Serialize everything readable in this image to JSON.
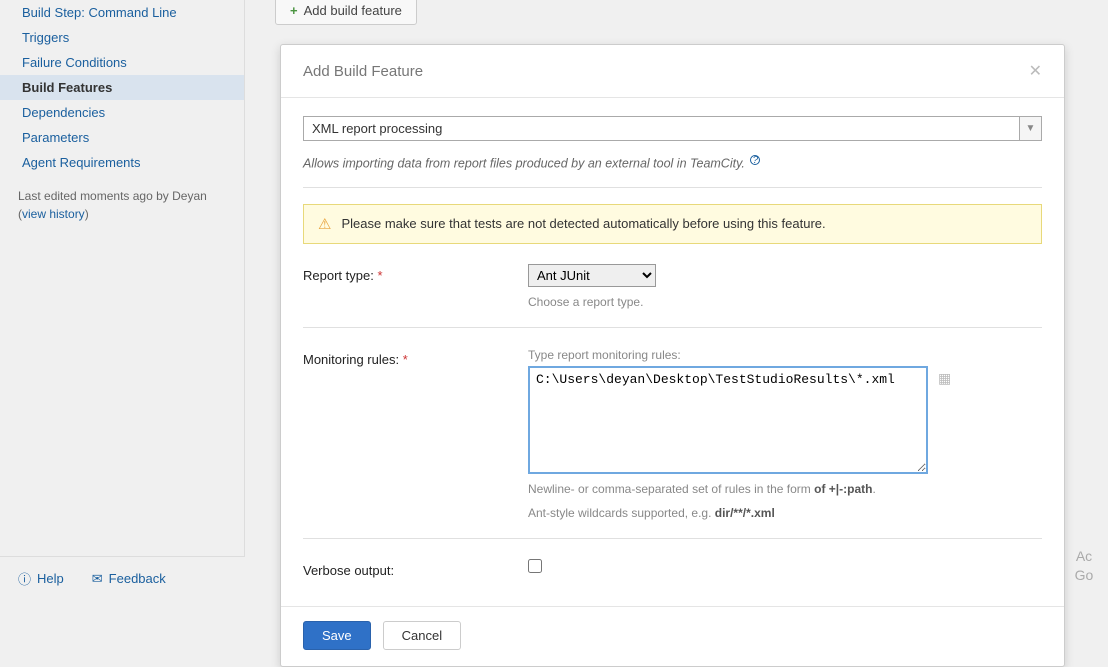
{
  "sidebar": {
    "items": [
      {
        "label": "Build Step: Command Line"
      },
      {
        "label": "Triggers"
      },
      {
        "label": "Failure Conditions"
      },
      {
        "label": "Build Features"
      },
      {
        "label": "Dependencies"
      },
      {
        "label": "Parameters"
      },
      {
        "label": "Agent Requirements"
      }
    ],
    "meta_prefix": "Last edited",
    "meta_time": "moments ago by Deyan",
    "meta_link": "view history"
  },
  "footer": {
    "help": "Help",
    "feedback": "Feedback"
  },
  "toolbar": {
    "add_feature": "Add build feature"
  },
  "dialog": {
    "title": "Add Build Feature",
    "selected_feature": "XML report processing",
    "description": "Allows importing data from report files produced by an external tool in TeamCity.",
    "warning": "Please make sure that tests are not detected automatically before using this feature.",
    "report_type": {
      "label": "Report type:",
      "value": "Ant JUnit",
      "hint": "Choose a report type."
    },
    "monitoring_rules": {
      "label": "Monitoring rules:",
      "caption": "Type report monitoring rules:",
      "value": "C:\\Users\\deyan\\Desktop\\TestStudioResults\\*.xml",
      "hint1_pre": "Newline- or comma-separated set of rules in the form ",
      "hint1_strong": "of +|-:path",
      "hint1_post": ".",
      "hint2_pre": "Ant-style wildcards supported, e.g. ",
      "hint2_strong": "dir/**/*.xml"
    },
    "verbose_output": {
      "label": "Verbose output:",
      "checked": false
    },
    "buttons": {
      "save": "Save",
      "cancel": "Cancel"
    }
  },
  "right": {
    "line1": "Ac",
    "line2": "Go"
  }
}
